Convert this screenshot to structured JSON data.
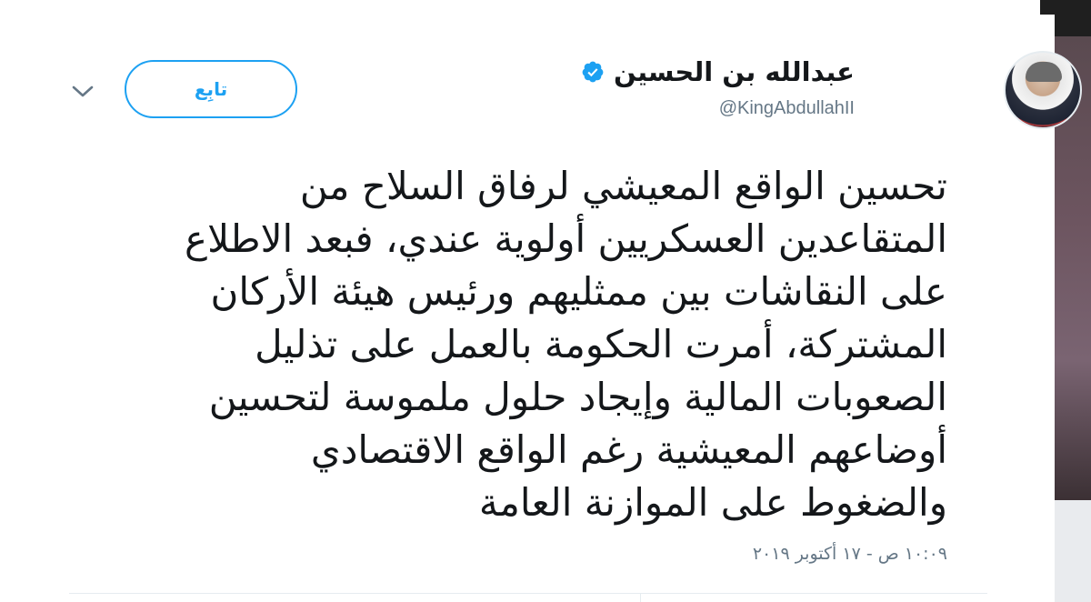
{
  "tweet": {
    "display_name": "عبدالله بن الحسين",
    "handle": "@KingAbdullahII",
    "verified": true,
    "follow_label": "تابِع",
    "text": "تحسين الواقع المعيشي لرفاق السلاح من\nالمتقاعدين العسكريين أولوية عندي، فبعد الاطلاع\nعلى النقاشات بين ممثليهم ورئيس هيئة الأركان\nالمشتركة، أمرت الحكومة بالعمل على تذليل\nالصعوبات المالية وإيجاد حلول ملموسة لتحسين\nأوضاعهم المعيشية رغم الواقع الاقتصادي\nوالضغوط على الموازنة العامة",
    "timestamp": "١٠:٠٩ ص - ١٧ أكتوبر ٢٠١٩"
  },
  "icons": {
    "verified": "verified-badge-icon",
    "menu": "chevron-down-icon",
    "avatar": "profile-avatar"
  },
  "colors": {
    "accent": "#1da1f2",
    "text": "#14171a",
    "secondary_text": "#657786"
  }
}
